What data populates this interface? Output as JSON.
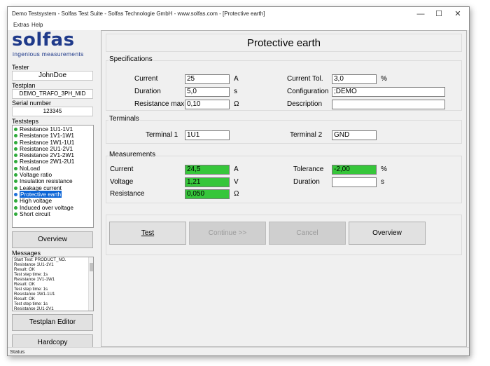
{
  "window": {
    "title": "Demo Testsystem - Solfas Test Suite - Solfas Technologie GmbH - www.solfas.com - [Protective earth]",
    "controls": {
      "minimize": "—",
      "maximize": "☐",
      "close": "✕"
    }
  },
  "menu": {
    "items": [
      "Extras",
      "Help"
    ]
  },
  "logo": {
    "text": "solfas",
    "subtitle": "ingenious measurements"
  },
  "sidebar": {
    "tester_label": "Tester",
    "tester_value": "JohnDoe",
    "testplan_label": "Testplan",
    "testplan_value": "DEMO_TRAFO_3PH_MID",
    "serial_label": "Serial number",
    "serial_value": "123345",
    "teststeps_label": "Teststeps",
    "teststeps": [
      "Resistance 1U1-1V1",
      "Resistance 1V1-1W1",
      "Resistance 1W1-1U1",
      "Resistance 2U1-2V1",
      "Resistance 2V1-2W1",
      "Resistance 2W1-2U1",
      "NoLoad",
      "Voltage ratio",
      "Insulation resistance",
      "Leakage current",
      "Protective earth",
      "High voltage",
      "Induced over voltage",
      "Short circuit"
    ],
    "selected_step": "Protective earth",
    "overview_button": "Overview",
    "messages_label": "Messages",
    "messages": [
      "Start Test: PRODUCT_NO.",
      "Resistance 1U1-1V1",
      "Result: OK",
      "Test step time: 1s",
      "Resistance 1V1-1W1",
      "Result: OK",
      "Test step time: 1s",
      "Resistance 1W1-1U1",
      "Result: OK",
      "Test step time: 1s",
      "Resistance 2U1-2V1"
    ],
    "testplan_editor_button": "Testplan Editor",
    "hardcopy_button": "Hardcopy"
  },
  "main": {
    "heading": "Protective earth",
    "specifications": {
      "title": "Specifications",
      "current_label": "Current",
      "current_value": "25",
      "current_unit": "A",
      "duration_label": "Duration",
      "duration_value": "5,0",
      "duration_unit": "s",
      "resistance_label": "Resistance max.",
      "resistance_value": "0,10",
      "resistance_unit": "Ω",
      "current_tol_label": "Current Tol.",
      "current_tol_value": "3,0",
      "current_tol_unit": "%",
      "configuration_label": "Configuration",
      "configuration_value": ";DEMO",
      "description_label": "Description",
      "description_value": ""
    },
    "terminals": {
      "title": "Terminals",
      "terminal1_label": "Terminal 1",
      "terminal1_value": "1U1",
      "terminal2_label": "Terminal 2",
      "terminal2_value": "GND"
    },
    "measurements": {
      "title": "Measurements",
      "current_label": "Current",
      "current_value": "24,5",
      "current_unit": "A",
      "voltage_label": "Voltage",
      "voltage_value": "1,21",
      "voltage_unit": "V",
      "resistance_label": "Resistance",
      "resistance_value": "0,050",
      "resistance_unit": "Ω",
      "tolerance_label": "Tolerance",
      "tolerance_value": "-2,00",
      "tolerance_unit": "%",
      "duration_label": "Duration",
      "duration_value": "",
      "duration_unit": "s"
    },
    "buttons": {
      "test": "Test",
      "continue": "Continue >>",
      "cancel": "Cancel",
      "overview": "Overview"
    }
  },
  "status": {
    "text": "Status"
  },
  "colors": {
    "pass_green": "#36c63a",
    "selection_blue": "#0a64d6",
    "logo_blue": "#1f3a8a"
  }
}
